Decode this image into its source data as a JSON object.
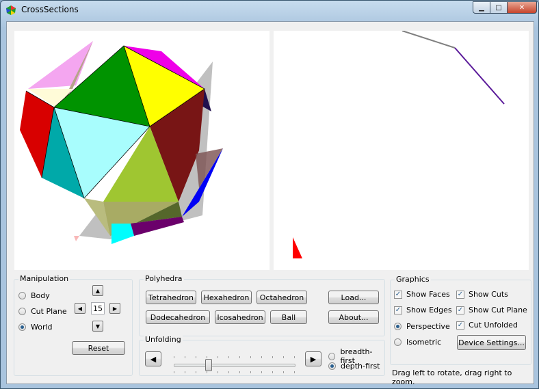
{
  "window": {
    "title": "CrossSections",
    "minimize": "▁",
    "maximize": "□",
    "close": "✕"
  },
  "manipulation": {
    "title": "Manipulation",
    "options": [
      {
        "label": "Body",
        "selected": false
      },
      {
        "label": "Cut Plane",
        "selected": false
      },
      {
        "label": "World",
        "selected": true
      }
    ],
    "step_value": "15",
    "up": "▲",
    "down": "▼",
    "left": "◀",
    "right": "▶",
    "reset_label": "Reset"
  },
  "polyhedra": {
    "title": "Polyhedra",
    "buttons": [
      "Tetrahedron",
      "Hexahedron",
      "Octahedron",
      "Dodecahedron",
      "Icosahedron",
      "Ball"
    ],
    "load_label": "Load...",
    "about_label": "About..."
  },
  "unfolding": {
    "title": "Unfolding",
    "prev": "◀",
    "next": "▶",
    "slider_fraction": 0.29,
    "options": [
      {
        "label": "breadth-first",
        "selected": false
      },
      {
        "label": "depth-first",
        "selected": true
      }
    ]
  },
  "graphics": {
    "title": "Graphics",
    "show_faces": "Show Faces",
    "show_edges": "Show Edges",
    "show_cuts": "Show Cuts",
    "show_cut_plane": "Show Cut Plane",
    "cut_unfolded": "Cut Unfolded",
    "perspective": "Perspective",
    "isometric": "Isometric",
    "device_settings": "Device Settings...",
    "check_mark": "✓"
  },
  "status_text": "Drag left to rotate, drag right to zoom."
}
